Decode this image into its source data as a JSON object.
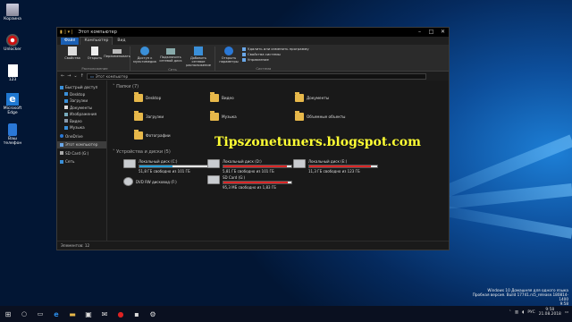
{
  "desktop": {
    "icons": [
      {
        "label": "Корзина"
      },
      {
        "label": "Unlocker"
      },
      {
        "label": "123"
      },
      {
        "label": "Microsoft Edge"
      },
      {
        "label": "Ваш телефон"
      }
    ]
  },
  "window": {
    "title": "Этот компьютер",
    "tabs": [
      "Файл",
      "Компьютер",
      "Вид"
    ],
    "ribbon": {
      "groups": [
        {
          "label": "Расположение",
          "buttons": [
            "Свойства",
            "Открыть",
            "Переименовать"
          ]
        },
        {
          "label": "Сеть",
          "buttons": [
            "Доступ к мультимедиа",
            "Подключить сетевой диск",
            "Добавить сетевое расположение"
          ]
        },
        {
          "label": "Система",
          "buttons": [
            "Открыть параметры"
          ],
          "small": [
            "Удалить или изменить программу",
            "Свойства системы",
            "Управление"
          ]
        }
      ]
    },
    "address": {
      "path": "Этот компьютер"
    },
    "nav": {
      "items": [
        "Быстрый доступ",
        "Desktop",
        "Загрузки",
        "Документы",
        "Изображения",
        "Видео",
        "Музыка",
        "OneDrive",
        "Этот компьютер",
        "SD Card (G:)",
        "Сеть"
      ]
    },
    "folders": {
      "header": "Папки (7)",
      "items": [
        "Desktop",
        "Видео",
        "Документы",
        "Загрузки",
        "Музыка",
        "Объемные объекты",
        "Фотографии"
      ]
    },
    "drives": {
      "header": "Устройства и диски (5)",
      "items": [
        {
          "name": "Локальный диск (C:)",
          "free": "51,8 ГБ свободно из 101 ГБ",
          "used_fraction": 0.49,
          "color": "#26a0da"
        },
        {
          "name": "Локальный диск (D:)",
          "free": "5,81 ГБ свободно из 101 ГБ",
          "used_fraction": 0.94,
          "color": "#da2626"
        },
        {
          "name": "Локальный диск (E:)",
          "free": "11,3 ГБ свободно из 123 ГБ",
          "used_fraction": 0.91,
          "color": "#da2626"
        },
        {
          "name": "DVD RW дисковод (F:)"
        },
        {
          "name": "SD Card (G:)",
          "free": "95,3 МБ свободно из 1,83 ГБ",
          "used_fraction": 0.95,
          "color": "#da2626"
        }
      ]
    },
    "status": "Элементов: 12"
  },
  "watermark": "Tipszonetuners.blogspot.com",
  "watermark_color": "#ffff33",
  "windows_info": {
    "line1": "Windows 10 Домашняя для одного языка",
    "line2": "Пробная версия. Build 17741.rs5_release.180814-1400",
    "line3": "9:58",
    "line4": "21.08.2018"
  },
  "tray": {
    "lang": "РУС",
    "time": "9:58",
    "date": "21.08.2018"
  }
}
